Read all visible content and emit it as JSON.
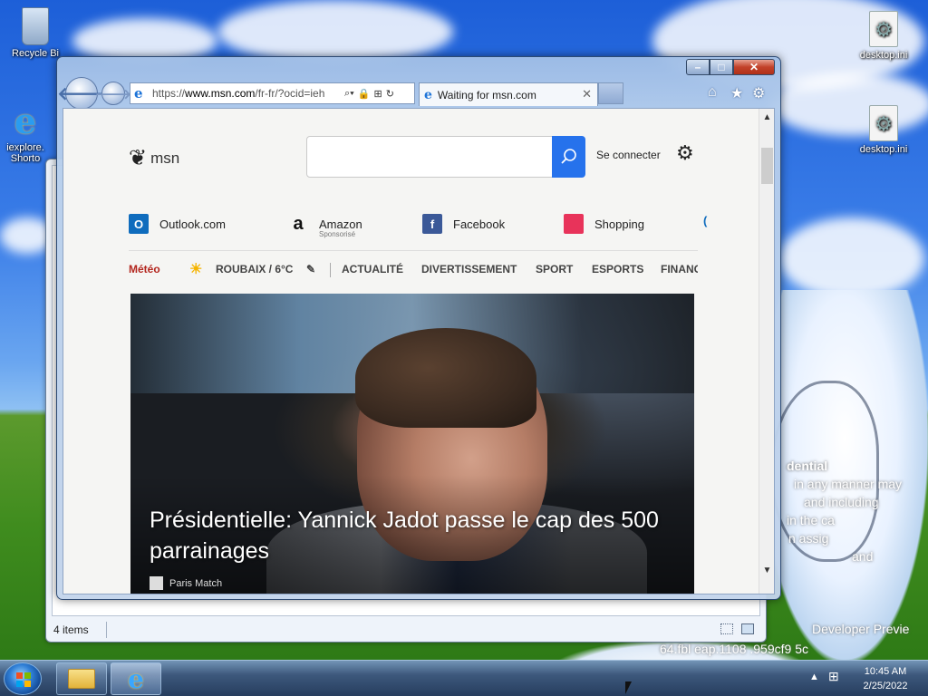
{
  "desktop": {
    "icons": [
      {
        "label": "Recycle Bi"
      },
      {
        "label": "iexplore.\nShorto"
      },
      {
        "label": "desktop.ini"
      },
      {
        "label": "desktop.ini"
      }
    ],
    "overlay_lines": [
      "dential",
      "in any manner may",
      "and including",
      "in the ca",
      "n assig",
      "and",
      "Developer Previe",
      "64.fbl     eap.1108     .959cf9      5c"
    ]
  },
  "explorer": {
    "status_items": "4 items"
  },
  "ie": {
    "address": {
      "prefix": "https://",
      "domain": "www.msn.com",
      "path": "/fr-fr/?ocid=ieh"
    },
    "tab_title": "Waiting for msn.com",
    "window_buttons": {
      "minimize": "–",
      "maximize": "□",
      "close": "✕"
    }
  },
  "msn": {
    "logo_text": "msn",
    "signin": "Se connecter",
    "quick_links": [
      {
        "label": "Outlook.com",
        "sub": ""
      },
      {
        "label": "Amazon",
        "sub": "Sponsorisé"
      },
      {
        "label": "Facebook",
        "sub": ""
      },
      {
        "label": "Shopping",
        "sub": ""
      }
    ],
    "nav": {
      "meteo": "Météo",
      "weather": "ROUBAIX / 6°C",
      "items": [
        "ACTUALITÉ",
        "DIVERTISSEMENT",
        "SPORT",
        "ESPORTS",
        "FINANC"
      ]
    },
    "hero": {
      "headline": "Présidentielle: Yannick Jadot passe le cap des 500 parrainages",
      "source": "Paris Match"
    }
  },
  "taskbar": {
    "time": "10:45 AM",
    "date": "2/25/2022"
  }
}
